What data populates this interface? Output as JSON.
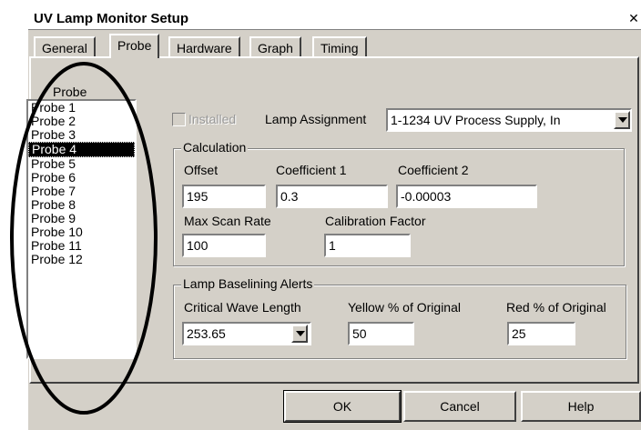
{
  "window": {
    "title": "UV Lamp Monitor Setup",
    "close_glyph": "✕"
  },
  "tabs": [
    {
      "label": "General"
    },
    {
      "label": "Probe"
    },
    {
      "label": "Hardware"
    },
    {
      "label": "Graph"
    },
    {
      "label": "Timing"
    }
  ],
  "probe_list": {
    "label": "Probe",
    "items": [
      "Probe 1",
      "Probe 2",
      "Probe 3",
      "Probe 4",
      "Probe 5",
      "Probe 6",
      "Probe 7",
      "Probe 8",
      "Probe 9",
      "Probe 10",
      "Probe 11",
      "Probe 12"
    ],
    "selected": "Probe 4"
  },
  "installed": {
    "label": "Installed",
    "checked": false
  },
  "lamp_assignment": {
    "label": "Lamp Assignment",
    "value": "1-1234    UV Process Supply, In"
  },
  "calculation": {
    "title": "Calculation",
    "offset": {
      "label": "Offset",
      "value": "195"
    },
    "coef1": {
      "label": "Coefficient 1",
      "value": "0.3"
    },
    "coef2": {
      "label": "Coefficient 2",
      "value": "-0.00003"
    },
    "max_scan_rate": {
      "label": "Max Scan Rate",
      "value": "100"
    },
    "calibration_factor": {
      "label": "Calibration Factor",
      "value": "1"
    }
  },
  "alerts": {
    "title": "Lamp Baselining Alerts",
    "critical_wave_length": {
      "label": "Critical Wave Length",
      "value": "253.65"
    },
    "yellow": {
      "label": "Yellow % of Original",
      "value": "50"
    },
    "red": {
      "label": "Red % of Original",
      "value": "25"
    }
  },
  "buttons": {
    "ok": "OK",
    "cancel": "Cancel",
    "help": "Help"
  }
}
